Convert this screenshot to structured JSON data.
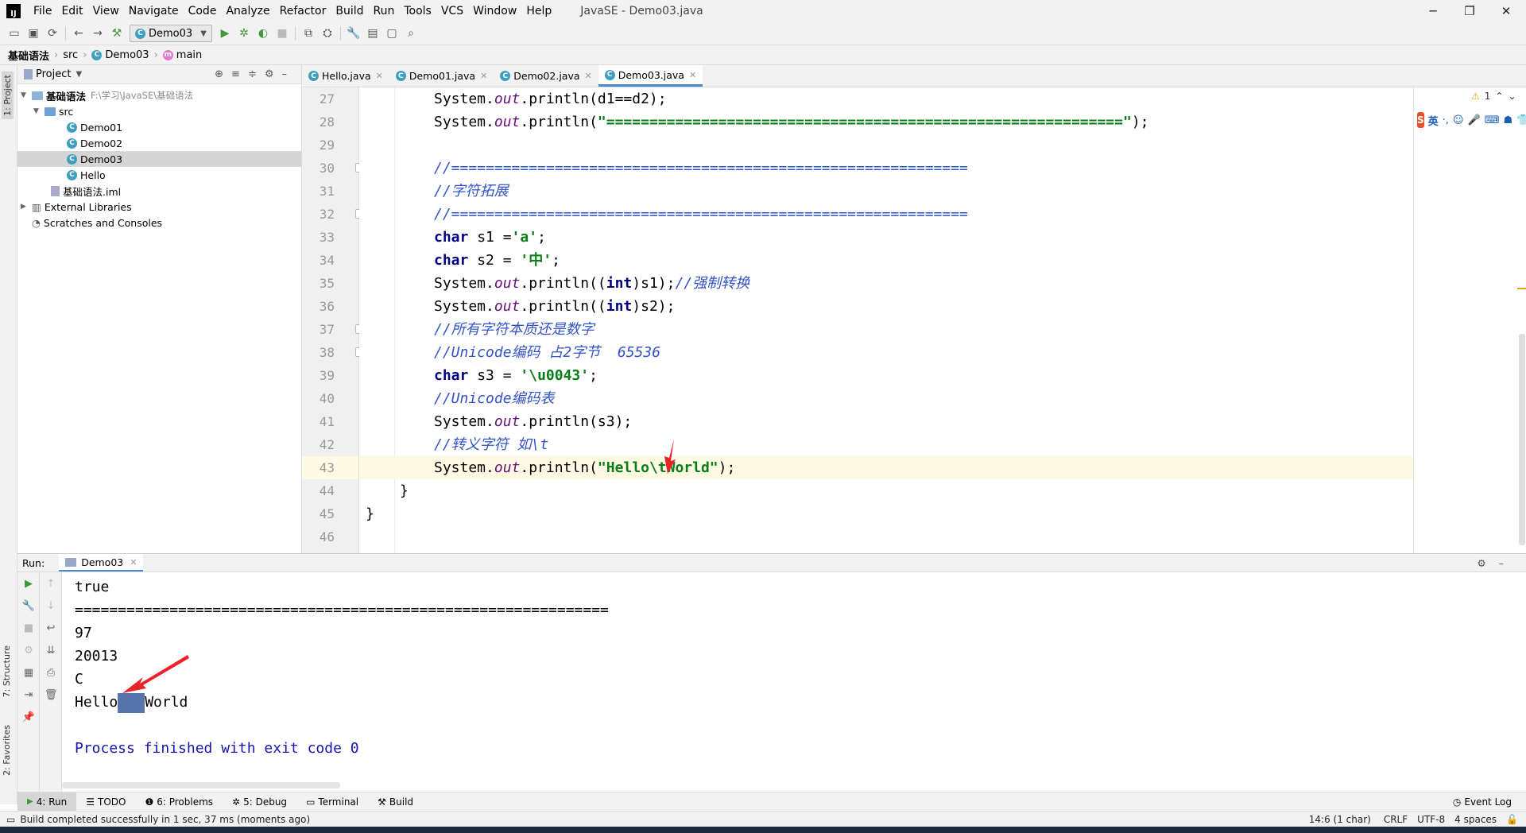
{
  "app": {
    "title": "JavaSE - Demo03.java",
    "logo": "IJ",
    "menu": [
      "File",
      "Edit",
      "View",
      "Navigate",
      "Code",
      "Analyze",
      "Refactor",
      "Build",
      "Run",
      "Tools",
      "VCS",
      "Window",
      "Help"
    ]
  },
  "toolbar": {
    "run_config": "Demo03"
  },
  "breadcrumb": [
    "基础语法",
    "src",
    "Demo03",
    "main"
  ],
  "project": {
    "header": "Project",
    "tree": [
      {
        "label": "基础语法",
        "path": "F:\\学习\\JavaSE\\基础语法"
      },
      {
        "label": "src"
      },
      {
        "label": "Demo01"
      },
      {
        "label": "Demo02"
      },
      {
        "label": "Demo03"
      },
      {
        "label": "Hello"
      },
      {
        "label": "基础语法.iml"
      },
      {
        "label": "External Libraries"
      },
      {
        "label": "Scratches and Consoles"
      }
    ]
  },
  "editor": {
    "tabs": [
      "Hello.java",
      "Demo01.java",
      "Demo02.java",
      "Demo03.java"
    ],
    "active_tab": "Demo03.java",
    "warnings": "1",
    "line_numbers": [
      "27",
      "28",
      "29",
      "30",
      "31",
      "32",
      "33",
      "34",
      "35",
      "36",
      "37",
      "38",
      "39",
      "40",
      "41",
      "42",
      "43",
      "44",
      "45",
      "46"
    ],
    "code": {
      "l27": [
        "System.",
        "out",
        ".println(d1==d2);"
      ],
      "l28": [
        "System.",
        "out",
        ".println(",
        "\"============================================================\"",
        ");"
      ],
      "l30": "//============================================================",
      "l31": "//字符拓展",
      "l32": "//============================================================",
      "l33": [
        "char",
        " s1 =",
        "'a'",
        ";"
      ],
      "l34": [
        "char",
        " s2 = ",
        "'中'",
        ";"
      ],
      "l35": [
        "System.",
        "out",
        ".println((",
        "int",
        ")s1);",
        "//强制转换"
      ],
      "l36": [
        "System.",
        "out",
        ".println((",
        "int",
        ")s2);"
      ],
      "l37": "//所有字符本质还是数字",
      "l38": "//Unicode编码 占2字节  65536",
      "l39": [
        "char",
        " s3 = ",
        "'\\u0043'",
        ";"
      ],
      "l40": "//Unicode编码表",
      "l41": [
        "System.",
        "out",
        ".println(s3);"
      ],
      "l42": "//转义字符 如\\t",
      "l43": [
        "System.",
        "out",
        ".println(",
        "\"Hello\\tWorld\"",
        ");"
      ],
      "l44": "}",
      "l45": "}"
    }
  },
  "run_panel": {
    "label": "Run:",
    "tab": "Demo03",
    "output": [
      "true",
      "==============================================================",
      "97",
      "20013",
      "C"
    ],
    "hello": "Hello",
    "world": "World",
    "finished": "Process finished with exit code 0"
  },
  "bottom_tabs": [
    "4: Run",
    "TODO",
    "6: Problems",
    "5: Debug",
    "Terminal",
    "Build"
  ],
  "event_log": "Event Log",
  "status": {
    "message": "Build completed successfully in 1 sec, 37 ms (moments ago)",
    "position": "14:6 (1 char)",
    "line_sep": "CRLF",
    "encoding": "UTF-8",
    "indent": "4 spaces"
  },
  "side_tabs": {
    "project": "1: Project",
    "structure": "7: Structure",
    "favorites": "2: Favorites"
  },
  "ime": {
    "lang": "英"
  },
  "colors": {
    "accent": "#4a88c7",
    "keyword": "#000080",
    "string": "#067d17",
    "comment": "#3354c6",
    "field": "#660e7a",
    "selection": "#5874ad",
    "annotation_arrow": "#e8232a"
  }
}
